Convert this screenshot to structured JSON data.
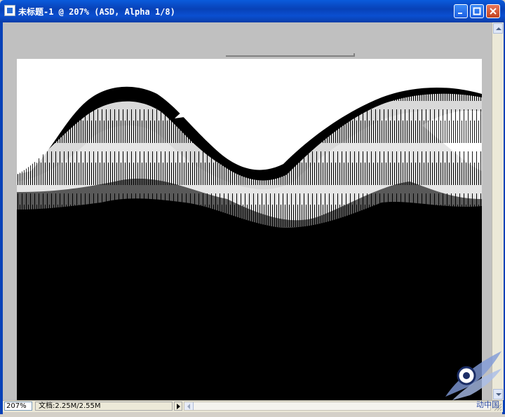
{
  "window": {
    "title": "未标题-1 @ 207% (ASD, Alpha 1/8)",
    "buttons": {
      "minimize": "minimize-icon",
      "maximize": "maximize-icon",
      "close": "close-icon"
    }
  },
  "status": {
    "zoom": "207%",
    "doc_info": "文档:2.25M/2.55M"
  },
  "watermark": {
    "text": "动中国"
  },
  "colors": {
    "titlebar": "#0a4fd1",
    "canvas_black": "#000000",
    "canvas_white": "#ffffff",
    "workspace": "#c0c0c0"
  }
}
